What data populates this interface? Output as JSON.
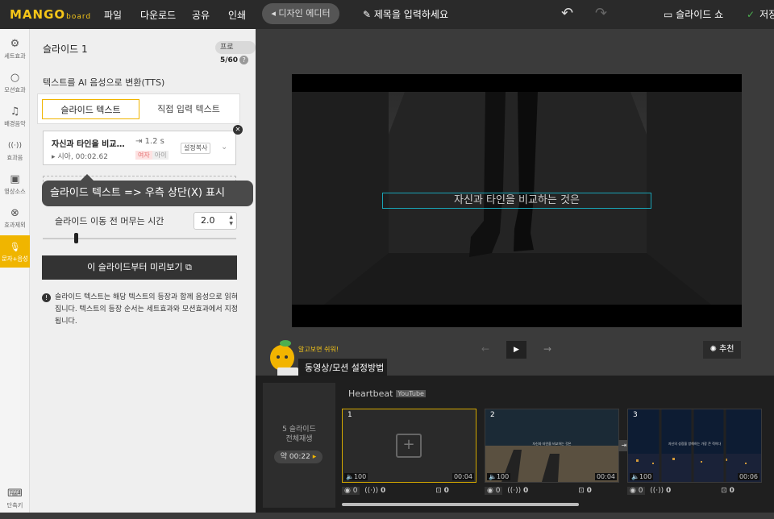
{
  "app": {
    "logo": "MANGO",
    "logo_sub": "board"
  },
  "top_menu": [
    "파일",
    "다운로드",
    "공유",
    "인쇄"
  ],
  "toolbar": {
    "back_label": "◂ 디자인 에디터",
    "title_placeholder": "제목을 입력하세요",
    "slideshow_label": "슬라이드 쇼",
    "save_label": "저장"
  },
  "sidebar": {
    "items": [
      {
        "label": "세트효과",
        "icon": "gear-icon",
        "glyph": "⚙"
      },
      {
        "label": "모션효과",
        "icon": "circle-icon",
        "glyph": "○"
      },
      {
        "label": "배경음악",
        "icon": "music-icon",
        "glyph": "♫"
      },
      {
        "label": "효과음",
        "icon": "sound-wave-icon",
        "glyph": "((·))"
      },
      {
        "label": "영상소스",
        "icon": "video-icon",
        "glyph": "▣"
      },
      {
        "label": "효과제외",
        "icon": "ban-icon",
        "glyph": "⊗"
      },
      {
        "label": "문자+음성",
        "icon": "microphone-icon",
        "glyph": "🎙"
      },
      {
        "label": "단축키",
        "icon": "keyboard-icon",
        "glyph": "⌨"
      }
    ]
  },
  "panel": {
    "title": "슬라이드 1",
    "pro_badge": {
      "prefix": "프로",
      "count": "5/60",
      "help": "?"
    },
    "tts_heading": "텍스트를 AI 음성으로 변환(TTS)",
    "tabs": [
      "슬라이드 텍스트",
      "직접 입력 텍스트"
    ],
    "tts_item": {
      "text": "자신과 타인을 비교…",
      "voice": "시아, 00:02.62",
      "duration": "1.2 s",
      "tag_female": "여자",
      "tag_child": "아이",
      "copy_label": "설정복사"
    },
    "tooltip": "슬라이드 텍스트 => 우측 상단(X) 표시",
    "move_label": "슬라이드 이동 전 머무는 시간",
    "move_value": "2.0",
    "preview_label": "이 슬라이드부터 미리보기",
    "info": "슬라이드 텍스트는 해당 텍스트의 등장과 함께 음성으로 읽혀집니다. 텍스트의 등장 순서는 세트효과와 모션효과에서 지정됩니다."
  },
  "canvas": {
    "caption": "자신과 타인을 비교하는 것은",
    "recommend_label": "추천"
  },
  "guide": {
    "tip": "알고보면 쉬워!",
    "label": "동영상/모션 설정방법"
  },
  "timeline": {
    "summary_label": "5 슬라이드\n전체재생",
    "summary_dur": "약 00:22",
    "music": "Heartbeat",
    "music_source": "YouTube",
    "slides": [
      {
        "num": "1",
        "vol": "100",
        "time": "00:04",
        "caption": "",
        "fx": "0",
        "sfx": "0",
        "trans": "0"
      },
      {
        "num": "2",
        "vol": "100",
        "time": "00:04",
        "caption": "자신과 타인을 비교하는 것은",
        "fx": "0",
        "sfx": "0",
        "trans": "0"
      },
      {
        "num": "3",
        "vol": "100",
        "time": "00:06",
        "caption": "자신의 성장을 방해하는 가장 큰 적이다",
        "fx": "0",
        "sfx": "0",
        "trans": "0"
      }
    ]
  }
}
